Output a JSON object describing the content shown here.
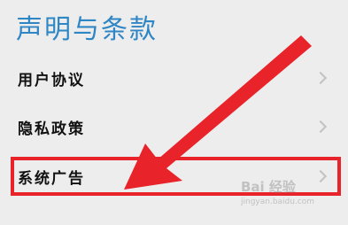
{
  "page": {
    "title": "声明与条款",
    "accent_color": "#2f86c4"
  },
  "items": [
    {
      "label": "用户协议"
    },
    {
      "label": "隐私政策"
    },
    {
      "label": "系统广告"
    }
  ],
  "annotation": {
    "highlight_color": "#e8232a",
    "highlighted_item": "系统广告"
  },
  "watermark": {
    "text": "Bai 经验",
    "sub": "jingyan.baidu.com"
  }
}
